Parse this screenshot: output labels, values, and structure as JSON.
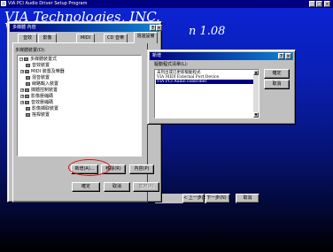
{
  "setup": {
    "window_title": "VIA PCI Audio Driver Setup Program",
    "minimize": "_",
    "maximize": "□",
    "close": "×",
    "bg_title_line1": "VIA Technologies, INC.",
    "bg_title_line2": "VI",
    "bg_version": "n 1.08",
    "back_button": "< 上一步(B)",
    "next_button": "下一步(N) >",
    "cancel_button": "取消"
  },
  "props": {
    "title": "多媒體 內容",
    "help": "?",
    "close": "×",
    "tabs": [
      {
        "label": "音效"
      },
      {
        "label": "影像"
      },
      {
        "label": "MIDI"
      },
      {
        "label": "CD 音樂"
      },
      {
        "label": "週邊設備"
      }
    ],
    "devices_label": "多媒體裝置(D):",
    "tree": [
      {
        "label": "多媒體裝置式",
        "level": 0,
        "expander": "−"
      },
      {
        "label": "音效裝置",
        "level": 1,
        "expander": ""
      },
      {
        "label": "MIDI 裝置及樂器",
        "level": 1,
        "expander": "+"
      },
      {
        "label": "混音裝置",
        "level": 1,
        "expander": ""
      },
      {
        "label": "線路輸入裝置",
        "level": 1,
        "expander": ""
      },
      {
        "label": "媒體控制裝置",
        "level": 1,
        "expander": "+"
      },
      {
        "label": "影像壓縮碼",
        "level": 1,
        "expander": "+"
      },
      {
        "label": "音效壓縮碼",
        "level": 1,
        "expander": "+"
      },
      {
        "label": "影像擷取裝置",
        "level": 1,
        "expander": ""
      },
      {
        "label": "搖桿裝置",
        "level": 1,
        "expander": ""
      }
    ],
    "add_button": "新增(A)...",
    "remove_button": "移除(R)",
    "properties_button": "內容(P)",
    "ok_button": "確定",
    "cancel_button": "取消",
    "apply_button": "套用(A)"
  },
  "add_dialog": {
    "title": "新增",
    "help": "?",
    "close": "×",
    "list_label": "驅動程式清單(L):",
    "items": [
      {
        "label": "未列出或已更新驅動程式",
        "selected": false
      },
      {
        "label": "VIA MIDI External Port Device",
        "selected": false
      },
      {
        "label": "VIA PCI Audio controller",
        "selected": true
      }
    ],
    "ok_button": "確定",
    "cancel_button": "取消"
  },
  "colors": {
    "titlebar": "#000080",
    "highlight_ring": "#e01010"
  }
}
